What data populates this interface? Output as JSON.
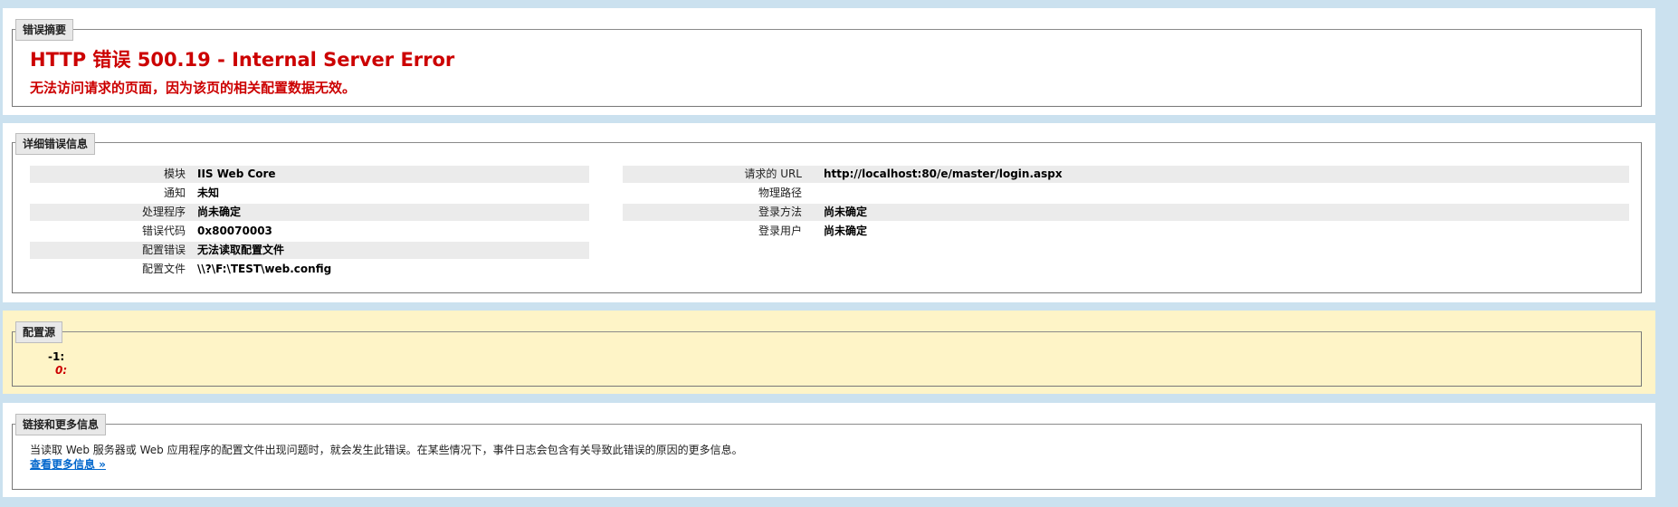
{
  "summary": {
    "legend": "错误摘要",
    "title": "HTTP 错误 500.19 - Internal Server Error",
    "subtitle": "无法访问请求的页面，因为该页的相关配置数据无效。"
  },
  "details": {
    "legend": "详细错误信息",
    "left": [
      {
        "label": "模块",
        "value": "IIS Web Core"
      },
      {
        "label": "通知",
        "value": "未知"
      },
      {
        "label": "处理程序",
        "value": "尚未确定"
      },
      {
        "label": "错误代码",
        "value": "0x80070003"
      },
      {
        "label": "配置错误",
        "value": "无法读取配置文件"
      },
      {
        "label": "配置文件",
        "value": "\\\\?\\F:\\TEST\\web.config"
      }
    ],
    "right": [
      {
        "label": "请求的 URL",
        "value": "http://localhost:80/e/master/login.aspx"
      },
      {
        "label": "物理路径",
        "value": ""
      },
      {
        "label": "登录方法",
        "value": "尚未确定"
      },
      {
        "label": "登录用户",
        "value": "尚未确定"
      }
    ]
  },
  "config_source": {
    "legend": "配置源",
    "line1": "-1:",
    "line2": "0:"
  },
  "more_info": {
    "legend": "链接和更多信息",
    "text": "当读取 Web 服务器或 Web 应用程序的配置文件出现问题时，就会发生此错误。在某些情况下，事件日志会包含有关导致此错误的原因的更多信息。",
    "link": "查看更多信息 »"
  }
}
